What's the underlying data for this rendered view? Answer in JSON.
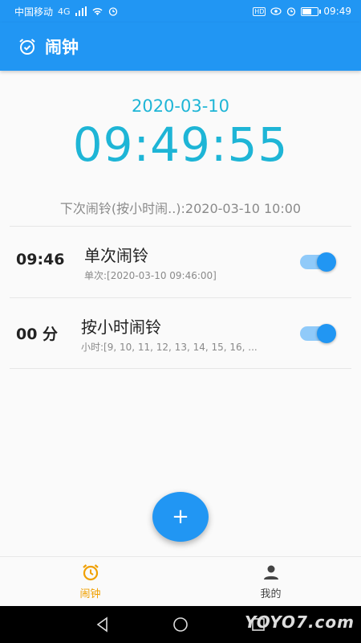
{
  "status_bar": {
    "carrier": "中国移动",
    "network": "4G",
    "time": "09:49",
    "badge": "HD",
    "battery_level": 0.6,
    "icons": [
      "signal-icon",
      "wifi-icon",
      "alarm-icon",
      "hd-icon",
      "eye-icon",
      "battery-icon"
    ]
  },
  "app_bar": {
    "title": "闹钟",
    "icon": "alarm-clock-check-icon"
  },
  "clock": {
    "date": "2020-03-10",
    "time": "09:49:55"
  },
  "next_alarm": "下次闹铃(按小时闹..):2020-03-10 10:00",
  "alarms": [
    {
      "time": "09:46",
      "name": "单次闹铃",
      "detail": "单次:[2020-03-10 09:46:00]",
      "enabled": true
    },
    {
      "time": "00 分",
      "name": "按小时闹铃",
      "detail": "小时:[9, 10, 11, 12, 13, 14, 15, 16, ...",
      "enabled": true
    }
  ],
  "fab": {
    "label": "+"
  },
  "bottom_nav": {
    "items": [
      {
        "label": "闹钟",
        "icon": "alarm-clock-icon",
        "active": true
      },
      {
        "label": "我的",
        "icon": "person-icon",
        "active": false
      }
    ]
  },
  "watermark": "YOYO7.com",
  "colors": {
    "primary": "#2196f3",
    "clock": "#1eb5d6",
    "active_tab": "#f0a000",
    "toggle_track": "#90caf9"
  }
}
